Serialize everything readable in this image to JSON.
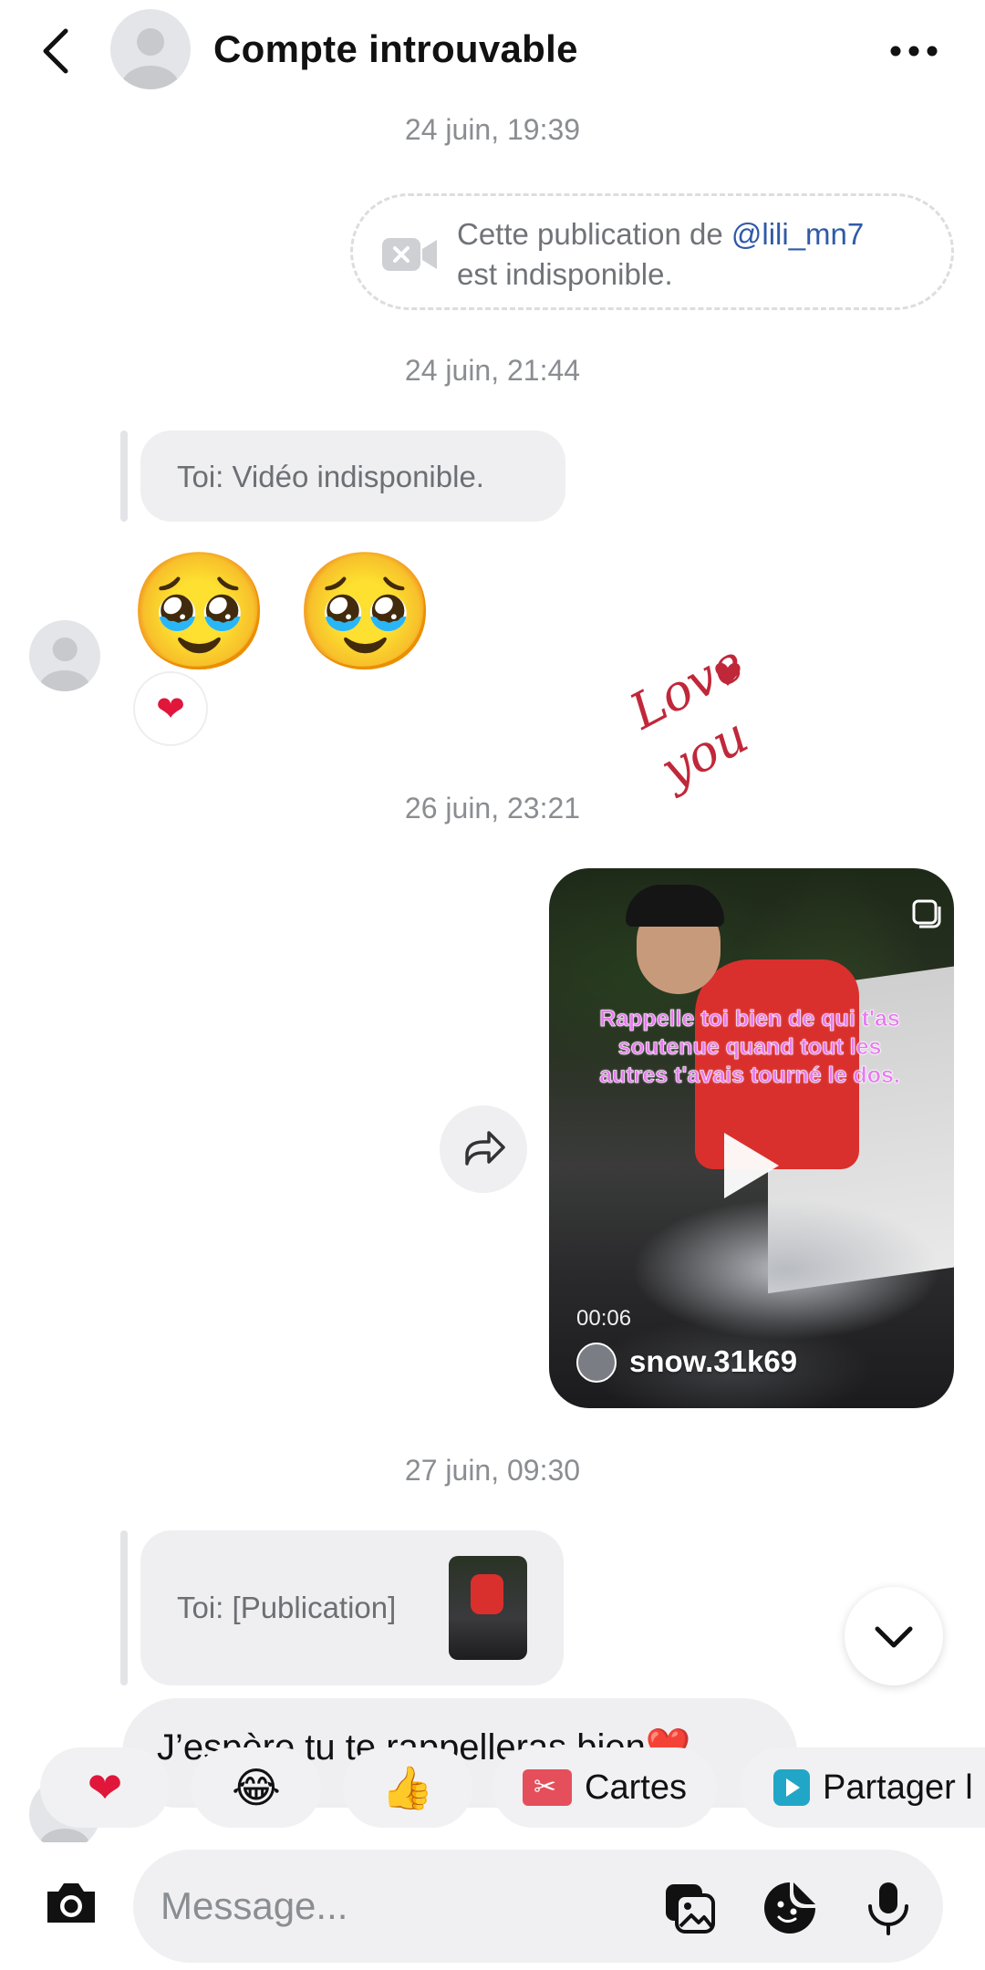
{
  "header": {
    "title": "Compte introuvable"
  },
  "timestamps": {
    "t1": "24 juin, 19:39",
    "t2": "24 juin, 21:44",
    "t3": "26 juin, 23:21",
    "t4": "27 juin, 09:30"
  },
  "unavailable_post": {
    "prefix": "Cette publication de ",
    "mention": "@lili_mn7",
    "suffix": "est indisponible."
  },
  "reply1": {
    "text": "Toi: Vidéo indisponible."
  },
  "emoji_message": {
    "emojis": [
      "🥹",
      "🥹"
    ],
    "reaction": "❤"
  },
  "sticker": {
    "text1": "Love",
    "text2": "you"
  },
  "video_post": {
    "overlay_text": "Rappelle toi bien de qui t'as soutenue quand tout les autres t'avais tourné le dos.",
    "duration": "00:06",
    "username": "snow.31k69"
  },
  "reply2": {
    "text": "Toi: [Publication]"
  },
  "message": {
    "text": "J’espère tu te rappelleras bien❤️"
  },
  "reactions_bar": {
    "items": [
      {
        "emoji": "❤"
      },
      {
        "emoji": "😂"
      },
      {
        "emoji": "👍"
      },
      {
        "label": "Cartes"
      },
      {
        "label": "Partager l"
      }
    ]
  },
  "composer": {
    "placeholder": "Message..."
  },
  "colors": {
    "accent_link": "#2f5aa8",
    "heart": "#e0163a",
    "overlay_text": "#e879f0"
  }
}
